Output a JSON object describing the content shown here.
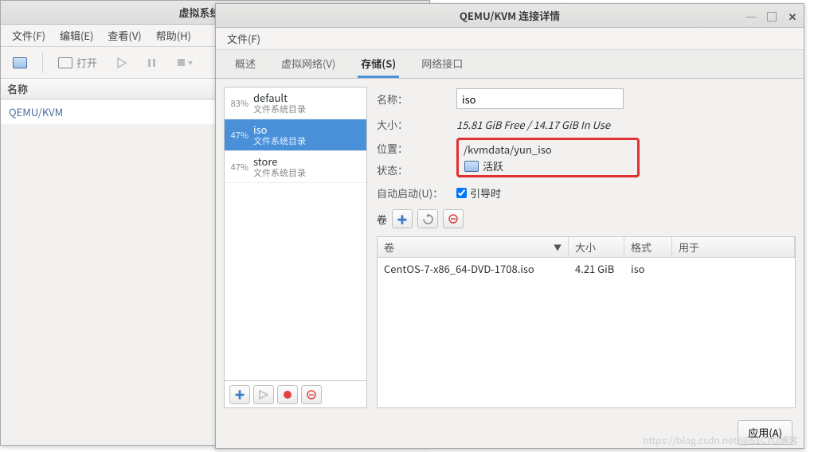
{
  "vm_manager": {
    "title": "虚拟系统管理器",
    "menus": {
      "file": "文件(F)",
      "edit": "编辑(E)",
      "view": "查看(V)",
      "help": "帮助(H)"
    },
    "toolbar": {
      "open": "打开"
    },
    "column_name": "名称",
    "rows": [
      {
        "name": "QEMU/KVM"
      }
    ]
  },
  "conn_details": {
    "title": "QEMU/KVM 连接详情",
    "menus": {
      "file": "文件(F)"
    },
    "tabs": {
      "overview": "概述",
      "vnet": "虚拟网络(V)",
      "storage": "存储(S)",
      "iface": "网络接口"
    },
    "pools": [
      {
        "pct": "83%",
        "name": "default",
        "type": "文件系统目录",
        "selected": false
      },
      {
        "pct": "47%",
        "name": "iso",
        "type": "文件系统目录",
        "selected": true
      },
      {
        "pct": "47%",
        "name": "store",
        "type": "文件系统目录",
        "selected": false
      }
    ],
    "props": {
      "name_label": "名称：",
      "name_value": "iso",
      "size_label": "大小：",
      "size_value": "15.81 GiB Free / 14.17 GiB In Use",
      "loc_label": "位置：",
      "loc_value": "/kvmdata/yun_iso",
      "state_label": "状态：",
      "state_value": "活跃",
      "auto_label": "自动启动(U)：",
      "auto_value": "引导时",
      "vol_label": "卷"
    },
    "vol_headers": {
      "name": "卷",
      "size": "大小",
      "fmt": "格式",
      "used": "用于"
    },
    "volumes": [
      {
        "name": "CentOS-7-x86_64-DVD-1708.iso",
        "size": "4.21 GiB",
        "fmt": "iso",
        "used": ""
      }
    ],
    "apply": "应用(A)"
  },
  "watermark": "https://blog.csdn.net/@51CTO博客"
}
